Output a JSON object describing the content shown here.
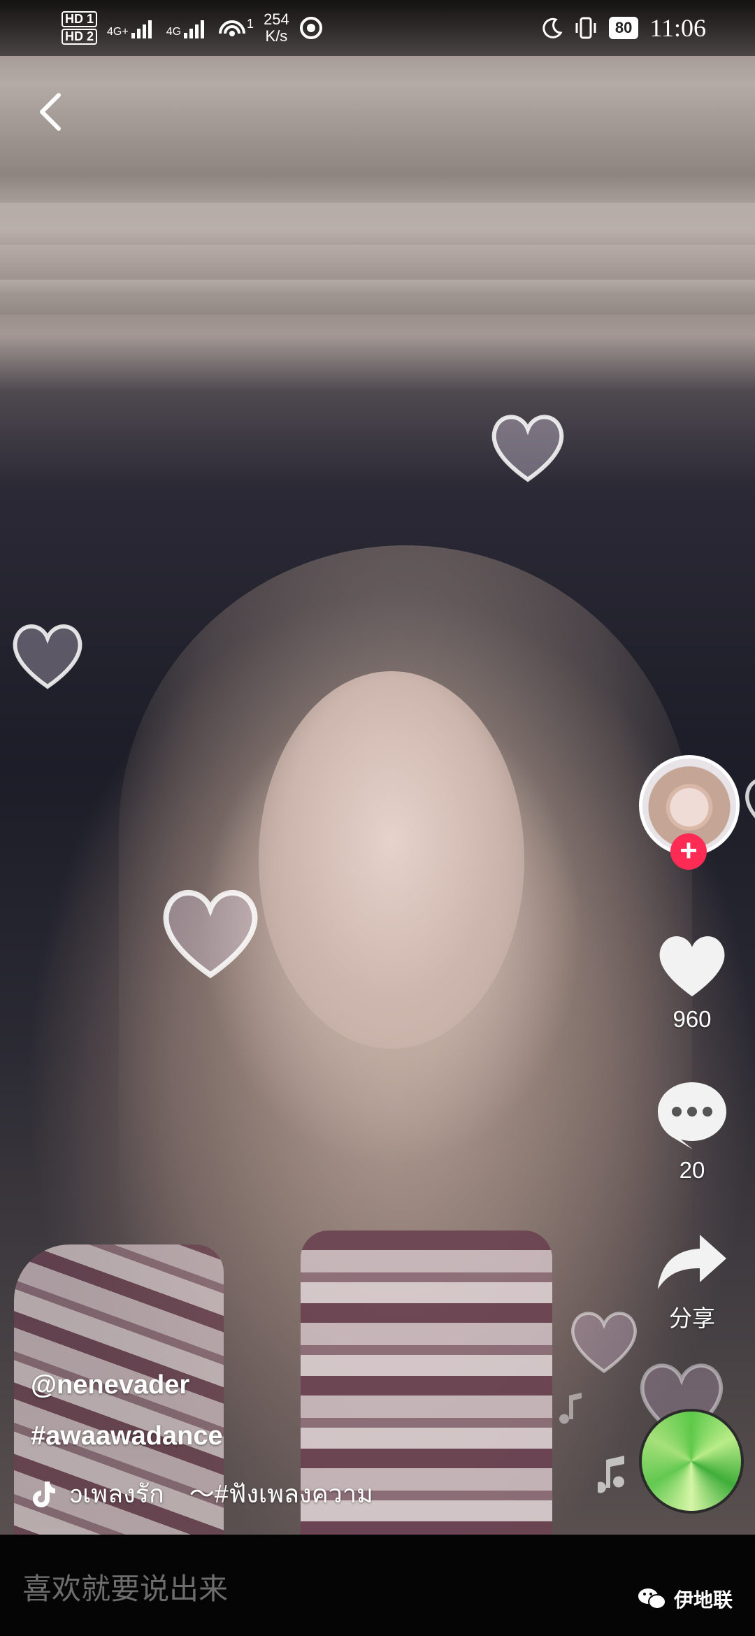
{
  "status_bar": {
    "hd1": "HD 1",
    "hd2": "HD 2",
    "sig1_label": "4G+",
    "sig2_label": "4G",
    "hotspot_count": "1",
    "net_speed_value": "254",
    "net_speed_unit": "K/s",
    "battery": "80",
    "time": "11:06"
  },
  "video": {
    "author": "@nenevader",
    "hashtag": "#awaawadance",
    "music": "ɔเพลงรัก　～#ฟังเพลงความ"
  },
  "actions": {
    "like_count": "960",
    "comment_count": "20",
    "share_label": "分享"
  },
  "bottom": {
    "comment_placeholder": "喜欢就要说出来",
    "watermark": "伊地联"
  },
  "colors": {
    "follow_red": "#fe2c55",
    "bar_bg": "#050505"
  }
}
